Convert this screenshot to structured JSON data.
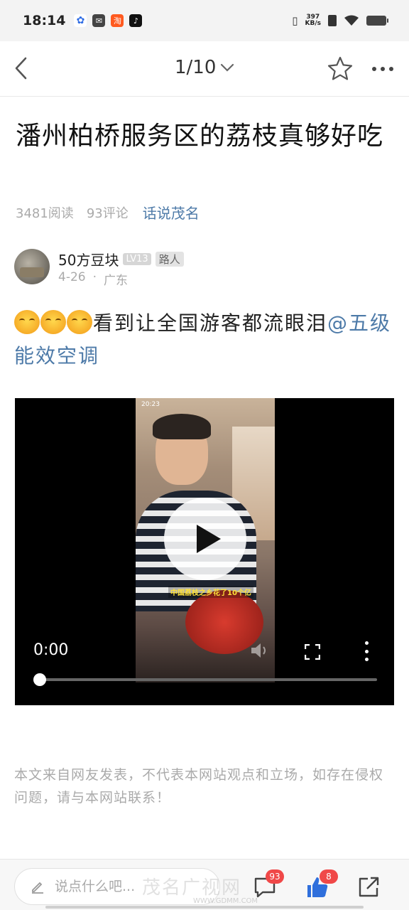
{
  "status_bar": {
    "time": "18:14",
    "net_speed_value": "397",
    "net_speed_unit": "KB/s",
    "icons": [
      "baidu-icon",
      "mail-icon",
      "taobao-icon",
      "tiktok-icon",
      "vibrate-icon",
      "sim-icon",
      "wifi-icon",
      "battery-icon"
    ]
  },
  "nav": {
    "page_indicator": "1/10"
  },
  "article": {
    "title": "潘州柏桥服务区的荔枝真够好吃",
    "reads": "3481阅读",
    "comments": "93评论",
    "topic": "话说茂名"
  },
  "author": {
    "name": "50方豆块",
    "level": "LV13",
    "role": "路人",
    "date": "4-26",
    "location": "广东",
    "separator": "·"
  },
  "body": {
    "text": "看到让全国游客都流眼泪",
    "mention": "@五级能效空调"
  },
  "video": {
    "current_time": "0:00",
    "progress": 0,
    "embedded_status_time": "20:23",
    "embedded_caption": "中国荔枝之乡花了10个亿"
  },
  "disclaimer": "本文来自网友发表，不代表本网站观点和立场，如存在侵权问题，请与本网站联系！",
  "bottom_bar": {
    "comment_placeholder": "说点什么吧...",
    "comment_count": "93",
    "like_count": "8"
  },
  "watermark": {
    "text": "茂名广视网",
    "url": "WWW.GDMM.COM"
  },
  "colors": {
    "link": "#4d7aa8",
    "like": "#2f6fdc",
    "badge": "#f04848"
  }
}
